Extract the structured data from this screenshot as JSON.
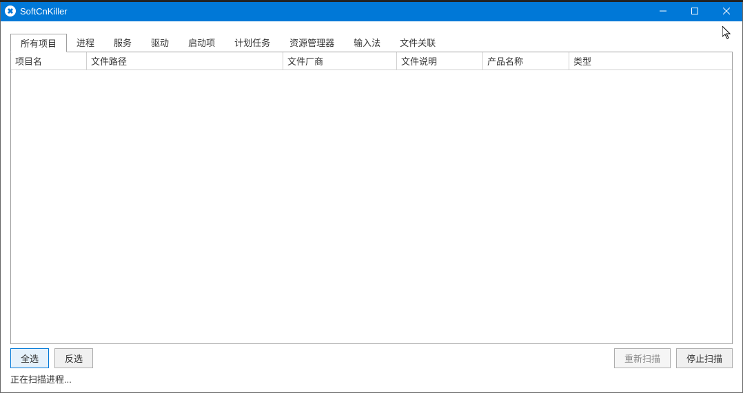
{
  "titlebar": {
    "title": "SoftCnKiller"
  },
  "tabs": [
    {
      "label": "所有项目",
      "active": true
    },
    {
      "label": "进程",
      "active": false
    },
    {
      "label": "服务",
      "active": false
    },
    {
      "label": "驱动",
      "active": false
    },
    {
      "label": "启动项",
      "active": false
    },
    {
      "label": "计划任务",
      "active": false
    },
    {
      "label": "资源管理器",
      "active": false
    },
    {
      "label": "输入法",
      "active": false
    },
    {
      "label": "文件关联",
      "active": false
    }
  ],
  "columns": [
    "项目名",
    "文件路径",
    "文件厂商",
    "文件说明",
    "产品名称",
    "类型"
  ],
  "buttons": {
    "select_all": "全选",
    "invert_selection": "反选",
    "rescan": "重新扫描",
    "stop_scan": "停止扫描"
  },
  "status": "正在扫描进程..."
}
